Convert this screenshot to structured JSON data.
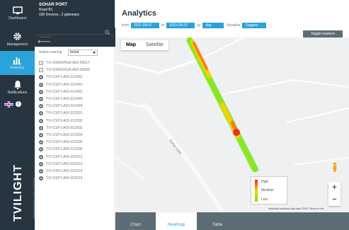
{
  "nav": {
    "items": [
      {
        "label": "Dashboard",
        "icon": "monitor-icon"
      },
      {
        "label": "Management",
        "icon": "gear-icon"
      },
      {
        "label": "Analytics",
        "icon": "bar-chart-icon"
      },
      {
        "label": "Notifications",
        "icon": "bell-icon"
      }
    ],
    "info": "!",
    "brand": "TVILIGHT",
    "brand_tagline": "ENGINEERING INTELLIGENCE"
  },
  "site": {
    "name": "SOHAR PORT",
    "road": "Road B1",
    "summary": "190 Devices , 2 gateways"
  },
  "search": {
    "placeholder": "search..."
  },
  "back_arrow": "🡐",
  "switch_naming": {
    "label": "Switch naming",
    "value": "Serial"
  },
  "devices": [
    {
      "name": "TVI-GW3GHGA-A02-00017",
      "type": "gateway"
    },
    {
      "name": "TVI-GW3GHGA-A02-00099",
      "type": "gateway"
    },
    {
      "name": "TVI-CSP1-A03-012462",
      "type": "node"
    },
    {
      "name": "TVI-CSP1-A03-012491",
      "type": "node"
    },
    {
      "name": "TVI-CSP1-A03-012492",
      "type": "node"
    },
    {
      "name": "TVI-CSP1-A03-012493",
      "type": "node"
    },
    {
      "name": "TVI-CSP1-A03-012494",
      "type": "node"
    },
    {
      "name": "TVI-CSP1-A03-012501",
      "type": "node"
    },
    {
      "name": "TVI-CSP1-A03-012502",
      "type": "node"
    },
    {
      "name": "TVI-CSP1-A03-012503",
      "type": "node"
    },
    {
      "name": "TVI-CSP1-A03-012504",
      "type": "node"
    },
    {
      "name": "TVI-CSP1-A03-012505",
      "type": "node"
    },
    {
      "name": "TVI-CSP1-A03-012506",
      "type": "node"
    },
    {
      "name": "TVI-CSP1-A03-012512",
      "type": "node"
    },
    {
      "name": "TVI-CSP1-A03-012513",
      "type": "node"
    },
    {
      "name": "TVI-CSP1-A03-012514",
      "type": "node"
    },
    {
      "name": "TVI-CSP1-A03-012515",
      "type": "node"
    }
  ],
  "analytics": {
    "title": "Analytics",
    "from_label": "from",
    "from_date": "2021-09-07",
    "to_label": "to",
    "to_date": "2021-09-21",
    "by_label": "by",
    "by_value": "day",
    "visualise_label": "Visualise",
    "visualise_value": "Triggers",
    "toggle_markers": "Toggle markers"
  },
  "map": {
    "tabs": [
      "Map",
      "Satellite"
    ],
    "active_tab": "Map",
    "road_label": "Sohar Gate",
    "legend": {
      "high": "High",
      "medium": "Medium",
      "low": "Low"
    },
    "attribution": "Keyboard shortcuts   Map data ©2021   Terms of Use",
    "zoom_in": "+",
    "zoom_out": "−"
  },
  "bottom_tabs": [
    "Chart",
    "Heatmap",
    "Table"
  ],
  "active_bottom_tab": "Heatmap",
  "colors": {
    "nav_bg": "#263540",
    "accent": "#2aa3d9",
    "tab_bar": "#5d6c75",
    "heat_high": "#ff1a1a",
    "heat_medium": "#ffd000",
    "heat_low": "#7be800"
  }
}
